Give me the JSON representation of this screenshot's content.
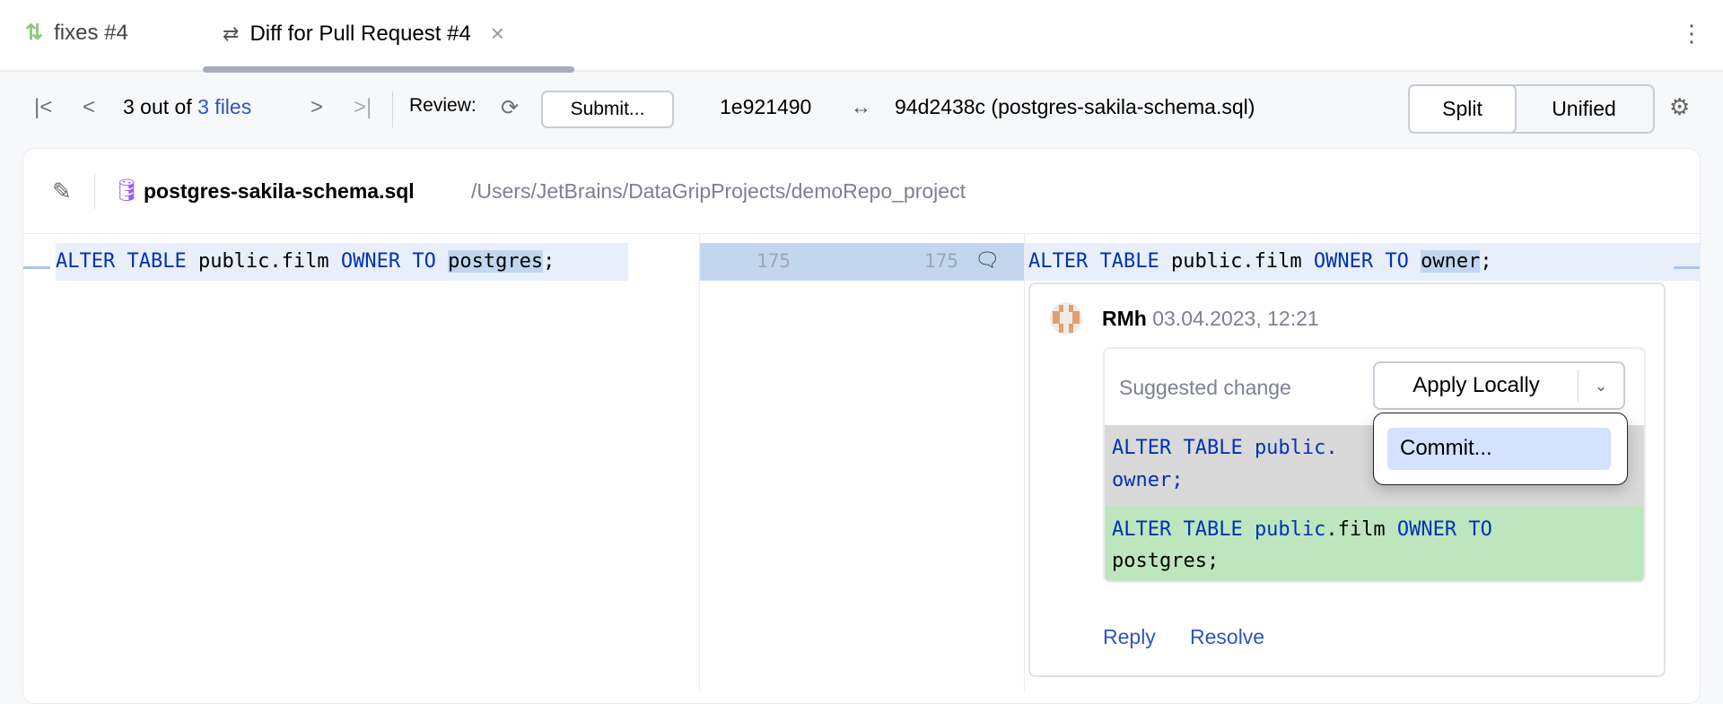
{
  "tabs": [
    {
      "label": "fixes #4",
      "icon": "pull-request-icon"
    },
    {
      "label": "Diff for Pull Request #4",
      "icon": "diff-icon",
      "close": "×"
    }
  ],
  "toolbar": {
    "position_prefix": "3 out of",
    "position_link": "3 files",
    "review_label": "Review:",
    "submit_label": "Submit...",
    "left_rev": "1e921490",
    "right_rev": "94d2438c (postgres-sakila-schema.sql)",
    "split_label": "Split",
    "unified_label": "Unified"
  },
  "file": {
    "name": "postgres-sakila-schema.sql",
    "path": "/Users/JetBrains/DataGripProjects/demoRepo_project"
  },
  "diff": {
    "left_line": "175",
    "right_line": "175",
    "left": {
      "kw1": "ALTER TABLE",
      "t1": " public.film ",
      "kw2": "OWNER TO",
      "t2": " ",
      "changed": "postgres",
      "t3": ";"
    },
    "right": {
      "kw1": "ALTER TABLE",
      "t1": " public.film ",
      "kw2": "OWNER TO",
      "t2": " ",
      "changed": "owner",
      "t3": ";"
    }
  },
  "comment": {
    "author": "RMh",
    "date": "03.04.2023, 12:21",
    "suggested_label": "Suggested change",
    "apply_label": "Apply Locally",
    "old_line1_kw": "ALTER TABLE public.",
    "old_line2": "owner;",
    "new_kw1": "ALTER TABLE public",
    "new_t1": ".film ",
    "new_kw2": "OWNER TO",
    "new_line2": "postgres;",
    "reply": "Reply",
    "resolve": "Resolve"
  },
  "dropdown": {
    "items": [
      "Commit..."
    ]
  },
  "colors": {
    "accent": "#2e55c4",
    "added": "#bee6be",
    "removed": "#d9d9d9",
    "changed_line": "#e8effa",
    "changed_word": "#c2d6f0"
  }
}
